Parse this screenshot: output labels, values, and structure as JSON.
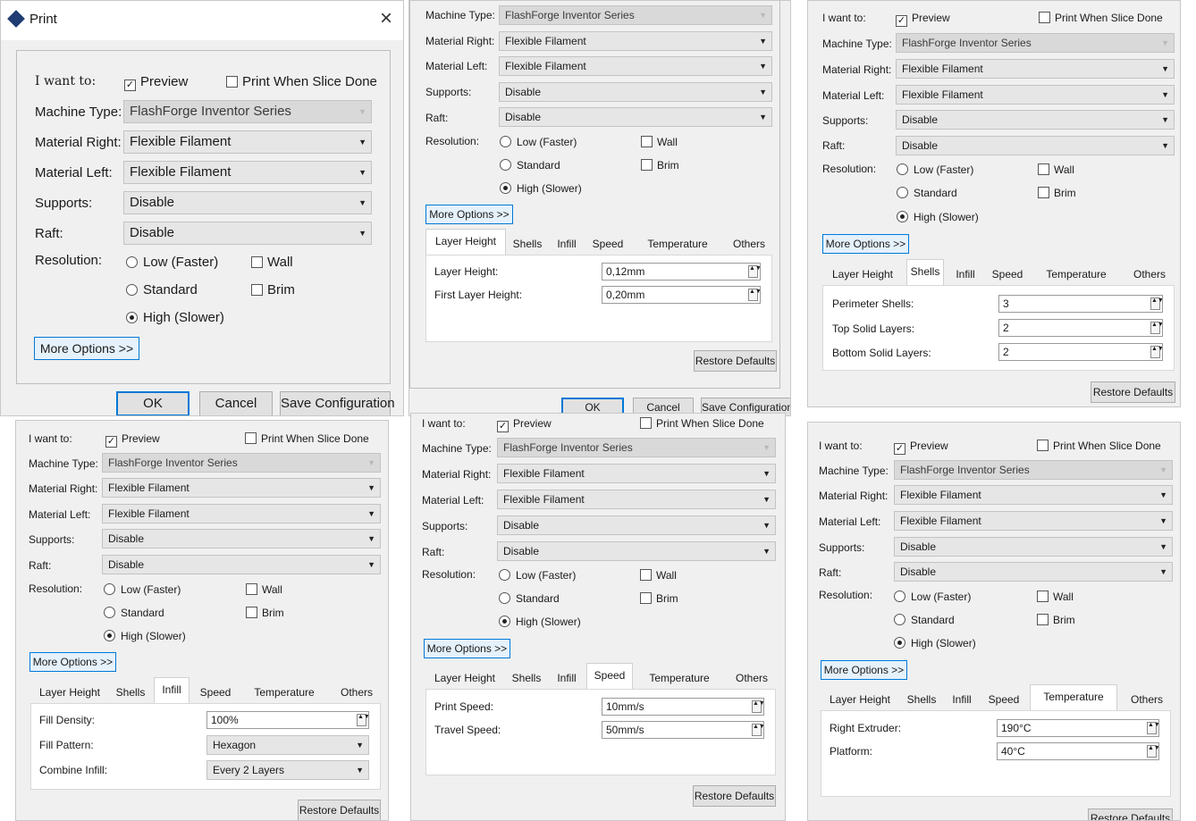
{
  "dialog": {
    "title": "Print",
    "close_glyph": "×",
    "i_want_to_label": "I want to:",
    "preview_label": "Preview",
    "print_when_done_label": "Print When Slice Done",
    "machine_type_label": "Machine Type:",
    "machine_type_value": "FlashForge Inventor Series",
    "material_right_label": "Material Right:",
    "material_right_value": "Flexible Filament",
    "material_left_label": "Material Left:",
    "material_left_value": "Flexible Filament",
    "supports_label": "Supports:",
    "supports_value": "Disable",
    "raft_label": "Raft:",
    "raft_value": "Disable",
    "resolution_label": "Resolution:",
    "res_low": "Low (Faster)",
    "res_standard": "Standard",
    "res_high": "High (Slower)",
    "wall_label": "Wall",
    "brim_label": "Brim",
    "more_options": "More Options >>",
    "ok": "OK",
    "cancel": "Cancel",
    "save_config": "Save Configuration",
    "restore_defaults": "Restore Defaults",
    "check_glyph": "✓",
    "arrow_glyph": "▼",
    "spin_glyph": "▲▼"
  },
  "tabs": [
    "Layer Height",
    "Shells",
    "Infill",
    "Speed",
    "Temperature",
    "Others"
  ],
  "layer_height": {
    "layer_height_label": "Layer Height:",
    "layer_height_value": "0,12mm",
    "first_layer_label": "First Layer Height:",
    "first_layer_value": "0,20mm"
  },
  "shells": {
    "perimeter_label": "Perimeter Shells:",
    "perimeter_value": "3",
    "top_label": "Top Solid Layers:",
    "top_value": "2",
    "bottom_label": "Bottom Solid Layers:",
    "bottom_value": "2"
  },
  "infill": {
    "density_label": "Fill Density:",
    "density_value": "100%",
    "pattern_label": "Fill Pattern:",
    "pattern_value": "Hexagon",
    "combine_label": "Combine Infill:",
    "combine_value": "Every 2 Layers"
  },
  "speed": {
    "print_label": "Print Speed:",
    "print_value": "10mm/s",
    "travel_label": "Travel Speed:",
    "travel_value": "50mm/s"
  },
  "temperature": {
    "right_extruder_label": "Right Extruder:",
    "right_extruder_value": "190°C",
    "platform_label": "Platform:",
    "platform_value": "40°C"
  },
  "colors": {
    "accent": "#0078d7",
    "panel_bg": "#f0f0f0",
    "combo_bg": "#e6e6e6"
  }
}
